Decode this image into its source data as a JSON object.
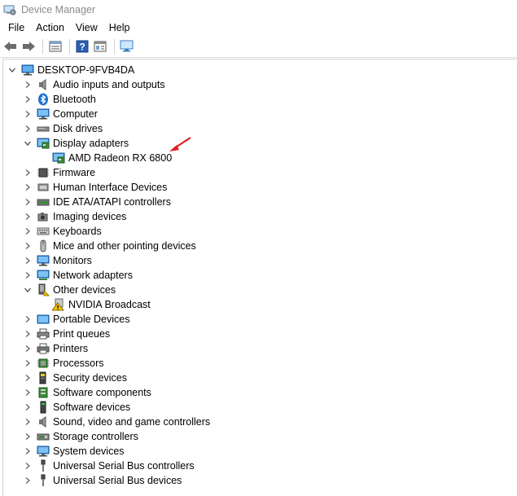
{
  "window": {
    "title": "Device Manager"
  },
  "menu": {
    "items": [
      "File",
      "Action",
      "View",
      "Help"
    ]
  },
  "toolbar": {
    "buttons": [
      {
        "name": "back-button",
        "icon": "arrow-left-icon"
      },
      {
        "name": "forward-button",
        "icon": "arrow-right-icon"
      },
      {
        "name": "properties-button",
        "icon": "properties-icon"
      },
      {
        "name": "help-button",
        "icon": "help-icon"
      },
      {
        "name": "view-button",
        "icon": "view-icon"
      },
      {
        "name": "scan-hardware-button",
        "icon": "monitor-scan-icon"
      }
    ]
  },
  "tree": {
    "root": "DESKTOP-9FVB4DA",
    "categories": [
      {
        "label": "Audio inputs and outputs",
        "icon": "speaker-icon",
        "expanded": false
      },
      {
        "label": "Bluetooth",
        "icon": "bluetooth-icon",
        "expanded": false
      },
      {
        "label": "Computer",
        "icon": "computer-icon",
        "expanded": false
      },
      {
        "label": "Disk drives",
        "icon": "disk-drive-icon",
        "expanded": false
      },
      {
        "label": "Display adapters",
        "icon": "display-adapter-icon",
        "expanded": true,
        "children": [
          {
            "label": "AMD Radeon RX 6800",
            "icon": "display-adapter-icon",
            "warning": false
          }
        ]
      },
      {
        "label": "Firmware",
        "icon": "firmware-icon",
        "expanded": false
      },
      {
        "label": "Human Interface Devices",
        "icon": "hid-icon",
        "expanded": false
      },
      {
        "label": "IDE ATA/ATAPI controllers",
        "icon": "ide-controller-icon",
        "expanded": false
      },
      {
        "label": "Imaging devices",
        "icon": "camera-icon",
        "expanded": false
      },
      {
        "label": "Keyboards",
        "icon": "keyboard-icon",
        "expanded": false
      },
      {
        "label": "Mice and other pointing devices",
        "icon": "mouse-icon",
        "expanded": false
      },
      {
        "label": "Monitors",
        "icon": "monitor-icon",
        "expanded": false
      },
      {
        "label": "Network adapters",
        "icon": "network-adapter-icon",
        "expanded": false
      },
      {
        "label": "Other devices",
        "icon": "other-devices-icon",
        "expanded": true,
        "children": [
          {
            "label": "NVIDIA Broadcast",
            "icon": "warning-device-icon",
            "warning": true
          }
        ]
      },
      {
        "label": "Portable Devices",
        "icon": "portable-device-icon",
        "expanded": false
      },
      {
        "label": "Print queues",
        "icon": "print-queue-icon",
        "expanded": false
      },
      {
        "label": "Printers",
        "icon": "printer-icon",
        "expanded": false
      },
      {
        "label": "Processors",
        "icon": "processor-icon",
        "expanded": false
      },
      {
        "label": "Security devices",
        "icon": "security-device-icon",
        "expanded": false
      },
      {
        "label": "Software components",
        "icon": "software-component-icon",
        "expanded": false
      },
      {
        "label": "Software devices",
        "icon": "software-device-icon",
        "expanded": false
      },
      {
        "label": "Sound, video and game controllers",
        "icon": "speaker-icon",
        "expanded": false
      },
      {
        "label": "Storage controllers",
        "icon": "storage-controller-icon",
        "expanded": false
      },
      {
        "label": "System devices",
        "icon": "system-device-icon",
        "expanded": false
      },
      {
        "label": "Universal Serial Bus controllers",
        "icon": "usb-icon",
        "expanded": false
      },
      {
        "label": "Universal Serial Bus devices",
        "icon": "usb-icon",
        "expanded": false
      }
    ]
  },
  "colors": {
    "annotation_arrow": "#e02020",
    "title_text": "#8a8a8a",
    "monitor_blue": "#2a7fd4",
    "chevron": "#555555"
  }
}
